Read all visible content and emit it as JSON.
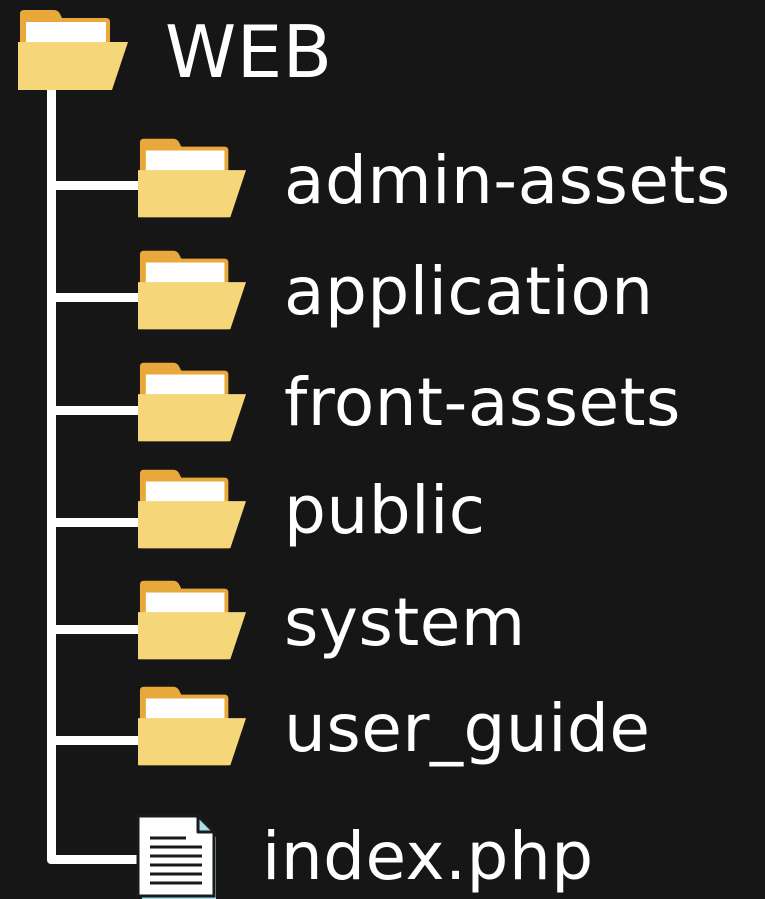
{
  "root": {
    "label": "WEB",
    "icon": "folder-icon"
  },
  "children": [
    {
      "label": "admin-assets",
      "icon": "folder-icon"
    },
    {
      "label": "application",
      "icon": "folder-icon"
    },
    {
      "label": "front-assets",
      "icon": "folder-icon"
    },
    {
      "label": "public",
      "icon": "folder-icon"
    },
    {
      "label": "system",
      "icon": "folder-icon"
    },
    {
      "label": "user_guide",
      "icon": "folder-icon"
    },
    {
      "label": "index.php",
      "icon": "file-icon"
    }
  ],
  "colors": {
    "background": "#161616",
    "text": "#ffffff",
    "folder_front": "#f5d77a",
    "folder_back": "#e8a93a",
    "file_fill": "#ffffff",
    "file_fold": "#a8dfe8"
  }
}
